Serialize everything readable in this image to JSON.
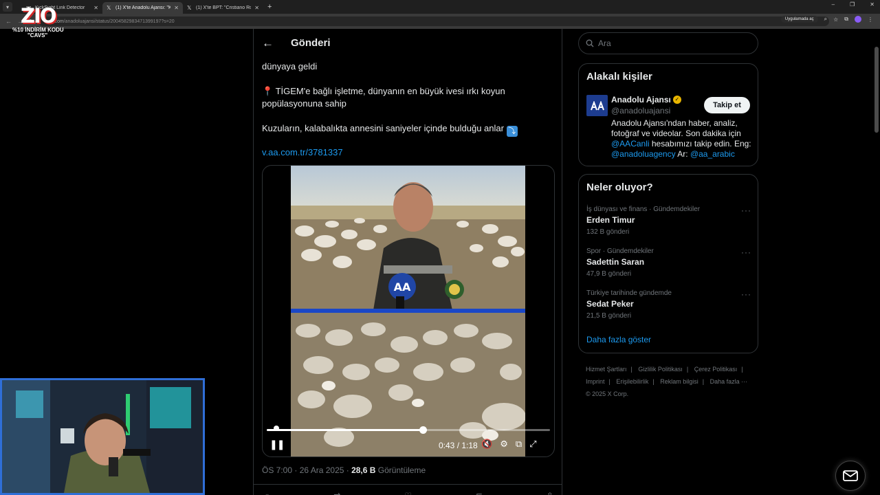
{
  "browser": {
    "tabs": [
      {
        "title": "KickSight Link Detector"
      },
      {
        "title": "(1) X'te Anadolu Ajansı: \"Kuzu..."
      },
      {
        "title": "(1) X'te BPT: \"Cristiano Ronaldo..."
      }
    ],
    "url_prefix": "x.com",
    "url_path": "/anadoluajansi/status/2004582983471399197?s=20",
    "app_pill": "Uygulamada aç"
  },
  "overlay": {
    "logo": "ZIO",
    "promo_line1": "%10 İNDİRİM KODU",
    "promo_line2": "\"CAVS\""
  },
  "post": {
    "header_title": "Gönderi",
    "text_line1": "dünyaya geldi",
    "text_para2": "TİGEM'e bağlı işletme, dünyanın en büyük ivesi ırkı koyun popülasyonuna sahip",
    "text_para3": "Kuzuların, kalabalıkta annesini saniyeler içinde bulduğu anlar",
    "link": "v.aa.com.tr/3781337",
    "video": {
      "time": "0:43 / 1:18",
      "progress": 0.55
    },
    "meta_time": "ÖS 7:00 · 26 Ara 2025 · ",
    "meta_views": "28,6 B",
    "meta_views_label": " Görüntüleme"
  },
  "sidebar": {
    "search_placeholder": "Ara",
    "related_title": "Alakalı kişiler",
    "account": {
      "name": "Anadolu Ajansı",
      "handle": "@anadoluajansi",
      "follow_label": "Takip et",
      "bio_part1": "Anadolu Ajansı'ndan haber, analiz, fotoğraf ve videolar. Son dakika için ",
      "bio_link1": "@AACanli",
      "bio_part2": " hesabımızı takip edin. Eng: ",
      "bio_link2": "@anadoluagency",
      "bio_part3": " Ar: ",
      "bio_link3": "@aa_arabic"
    },
    "trends_title": "Neler oluyor?",
    "trends": [
      {
        "category": "İş dünyası ve finans · Gündemdekiler",
        "name": "Erden Timur",
        "count": "132 B gönderi"
      },
      {
        "category": "Spor · Gündemdekiler",
        "name": "Sadettin Saran",
        "count": "47,9 B gönderi"
      },
      {
        "category": "Türkiye tarihinde gündemde",
        "name": "Sedat Peker",
        "count": "21,5 B gönderi"
      }
    ],
    "show_more": "Daha fazla göster",
    "footer": {
      "links": [
        "Hizmet Şartları",
        "Gizlilik Politikası",
        "Çerez Politikası",
        "Imprint",
        "Erişilebilirlik",
        "Reklam bilgisi",
        "Daha fazla ···"
      ],
      "copyright": "© 2025 X Corp."
    }
  },
  "icons": {
    "back": "arrow-left-icon",
    "search": "search-icon",
    "verified": "verified-badge-icon",
    "more": "more-dots-icon",
    "messages": "envelope-icon"
  },
  "colors": {
    "accent": "#1d9bf0",
    "background": "#000000",
    "border": "#2f3336"
  }
}
